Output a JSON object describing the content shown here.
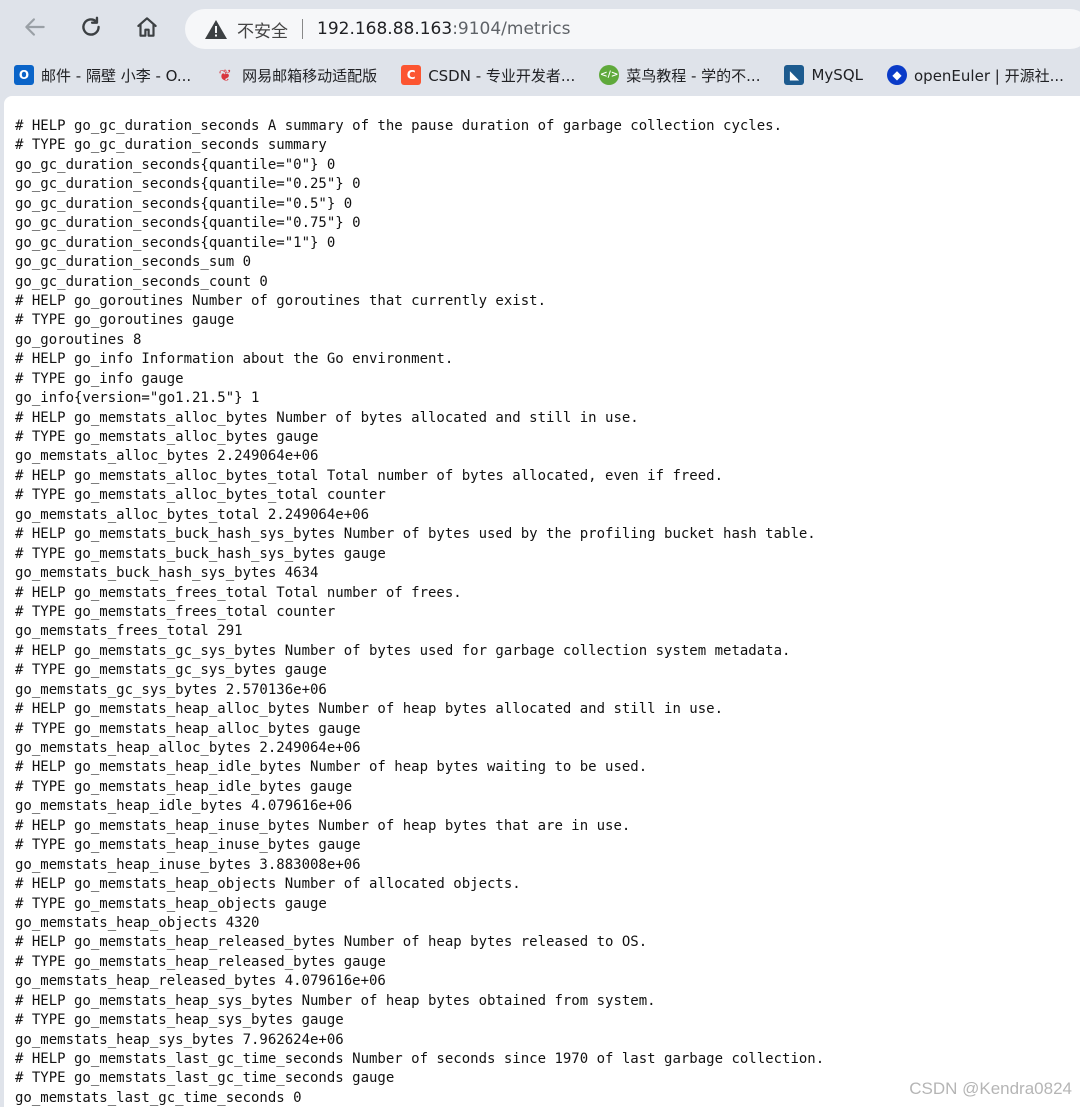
{
  "browser": {
    "insecure_label": "不安全",
    "url_host": "192.168.88.163",
    "url_rest": ":9104/metrics"
  },
  "bookmarks": [
    {
      "label": "邮件 - 隔壁 小李 - O...",
      "icon": "outlook-icon",
      "color": "#0a64c8"
    },
    {
      "label": "网易邮箱移动适配版",
      "icon": "netease-mail-icon",
      "color": "#d9363e"
    },
    {
      "label": "CSDN - 专业开发者...",
      "icon": "csdn-icon",
      "color": "#fc5531"
    },
    {
      "label": "菜鸟教程 - 学的不...",
      "icon": "runoob-icon",
      "color": "#5fa93b"
    },
    {
      "label": "MySQL",
      "icon": "mysql-icon",
      "color": "#1d5b8f"
    },
    {
      "label": "openEuler | 开源社...",
      "icon": "openeuler-icon",
      "color": "#0a3bc8"
    }
  ],
  "metrics_lines": [
    "# HELP go_gc_duration_seconds A summary of the pause duration of garbage collection cycles.",
    "# TYPE go_gc_duration_seconds summary",
    "go_gc_duration_seconds{quantile=\"0\"} 0",
    "go_gc_duration_seconds{quantile=\"0.25\"} 0",
    "go_gc_duration_seconds{quantile=\"0.5\"} 0",
    "go_gc_duration_seconds{quantile=\"0.75\"} 0",
    "go_gc_duration_seconds{quantile=\"1\"} 0",
    "go_gc_duration_seconds_sum 0",
    "go_gc_duration_seconds_count 0",
    "# HELP go_goroutines Number of goroutines that currently exist.",
    "# TYPE go_goroutines gauge",
    "go_goroutines 8",
    "# HELP go_info Information about the Go environment.",
    "# TYPE go_info gauge",
    "go_info{version=\"go1.21.5\"} 1",
    "# HELP go_memstats_alloc_bytes Number of bytes allocated and still in use.",
    "# TYPE go_memstats_alloc_bytes gauge",
    "go_memstats_alloc_bytes 2.249064e+06",
    "# HELP go_memstats_alloc_bytes_total Total number of bytes allocated, even if freed.",
    "# TYPE go_memstats_alloc_bytes_total counter",
    "go_memstats_alloc_bytes_total 2.249064e+06",
    "# HELP go_memstats_buck_hash_sys_bytes Number of bytes used by the profiling bucket hash table.",
    "# TYPE go_memstats_buck_hash_sys_bytes gauge",
    "go_memstats_buck_hash_sys_bytes 4634",
    "# HELP go_memstats_frees_total Total number of frees.",
    "# TYPE go_memstats_frees_total counter",
    "go_memstats_frees_total 291",
    "# HELP go_memstats_gc_sys_bytes Number of bytes used for garbage collection system metadata.",
    "# TYPE go_memstats_gc_sys_bytes gauge",
    "go_memstats_gc_sys_bytes 2.570136e+06",
    "# HELP go_memstats_heap_alloc_bytes Number of heap bytes allocated and still in use.",
    "# TYPE go_memstats_heap_alloc_bytes gauge",
    "go_memstats_heap_alloc_bytes 2.249064e+06",
    "# HELP go_memstats_heap_idle_bytes Number of heap bytes waiting to be used.",
    "# TYPE go_memstats_heap_idle_bytes gauge",
    "go_memstats_heap_idle_bytes 4.079616e+06",
    "# HELP go_memstats_heap_inuse_bytes Number of heap bytes that are in use.",
    "# TYPE go_memstats_heap_inuse_bytes gauge",
    "go_memstats_heap_inuse_bytes 3.883008e+06",
    "# HELP go_memstats_heap_objects Number of allocated objects.",
    "# TYPE go_memstats_heap_objects gauge",
    "go_memstats_heap_objects 4320",
    "# HELP go_memstats_heap_released_bytes Number of heap bytes released to OS.",
    "# TYPE go_memstats_heap_released_bytes gauge",
    "go_memstats_heap_released_bytes 4.079616e+06",
    "# HELP go_memstats_heap_sys_bytes Number of heap bytes obtained from system.",
    "# TYPE go_memstats_heap_sys_bytes gauge",
    "go_memstats_heap_sys_bytes 7.962624e+06",
    "# HELP go_memstats_last_gc_time_seconds Number of seconds since 1970 of last garbage collection.",
    "# TYPE go_memstats_last_gc_time_seconds gauge",
    "go_memstats_last_gc_time_seconds 0"
  ],
  "watermark": "CSDN @Kendra0824"
}
